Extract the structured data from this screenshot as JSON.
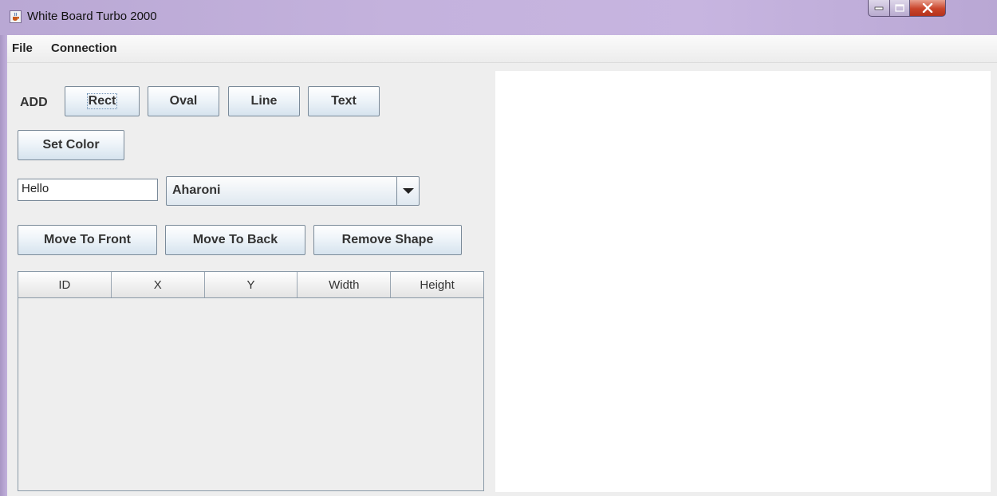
{
  "window": {
    "title": "White Board Turbo 2000",
    "icon": "java-cup-icon",
    "controls": [
      "minimize",
      "maximize",
      "close"
    ]
  },
  "menubar": {
    "items": [
      "File",
      "Connection"
    ]
  },
  "toolbar": {
    "add_label": "ADD",
    "shape_buttons": [
      "Rect",
      "Oval",
      "Line",
      "Text"
    ],
    "set_color_label": "Set Color"
  },
  "text_controls": {
    "text_value": "Hello",
    "font_selected": "Aharoni"
  },
  "arrange": {
    "move_front_label": "Move To Front",
    "move_back_label": "Move To Back",
    "remove_label": "Remove Shape"
  },
  "table": {
    "columns": [
      "ID",
      "X",
      "Y",
      "Width",
      "Height"
    ],
    "rows": []
  },
  "colors": {
    "title_bar": "#c4b2dd",
    "close_button": "#c9442a",
    "panel_bg": "#eeeeee",
    "canvas_bg": "#ffffff"
  }
}
